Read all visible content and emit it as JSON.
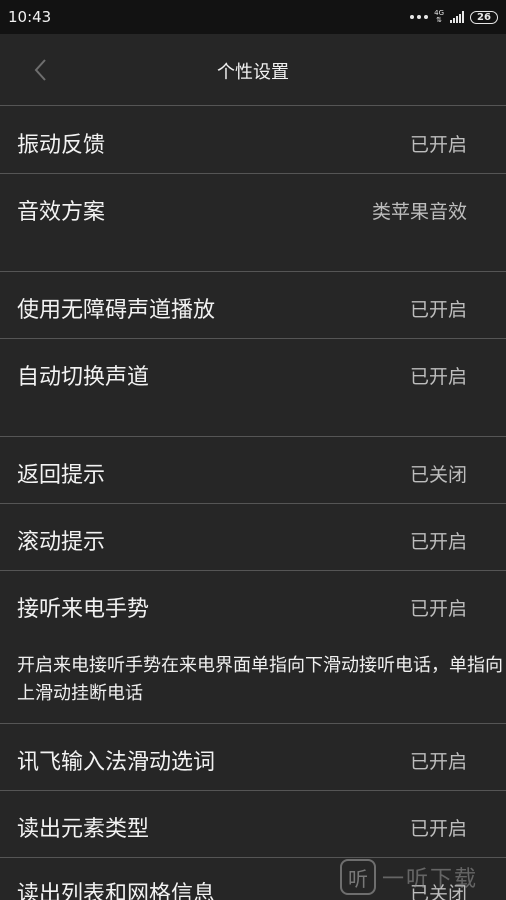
{
  "status_bar": {
    "time": "10:43",
    "network": "4G",
    "battery": "26"
  },
  "header": {
    "title": "个性设置"
  },
  "settings": [
    {
      "label": "振动反馈",
      "value": "已开启"
    },
    {
      "label": "音效方案",
      "value": "类苹果音效"
    },
    {
      "label": "使用无障碍声道播放",
      "value": "已开启"
    },
    {
      "label": "自动切换声道",
      "value": "已开启"
    },
    {
      "label": "返回提示",
      "value": "已关闭"
    },
    {
      "label": "滚动提示",
      "value": "已开启"
    },
    {
      "label": "接听来电手势",
      "value": "已开启"
    },
    {
      "label": "讯飞输入法滑动选词",
      "value": "已开启"
    },
    {
      "label": "读出元素类型",
      "value": "已开启"
    },
    {
      "label": "读出列表和网格信息",
      "value": "已关闭"
    }
  ],
  "gesture_description": "开启来电接听手势在来电界面单指向下滑动接听电话，单指向上滑动挂断电话",
  "watermark": {
    "logo_glyph": "听",
    "text": "一听下载"
  },
  "colors": {
    "background": "#262626",
    "status_bar": "#121212",
    "divider": "#555555",
    "label_text": "#f2f2f2",
    "value_text": "#bdbdbd"
  }
}
